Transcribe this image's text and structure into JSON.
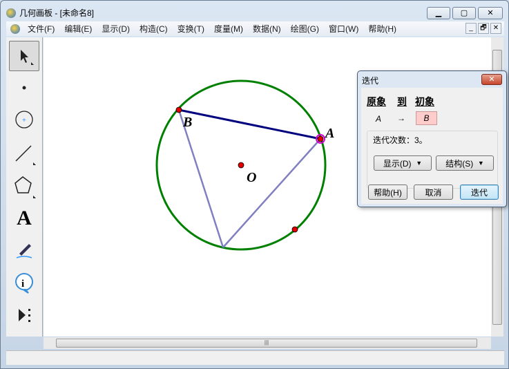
{
  "window": {
    "title": "几何画板 - [未命名8]",
    "min": "▁",
    "max": "▢",
    "close": "✕"
  },
  "menu": [
    "文件(F)",
    "编辑(E)",
    "显示(D)",
    "构造(C)",
    "变换(T)",
    "度量(M)",
    "数据(N)",
    "绘图(G)",
    "窗口(W)",
    "帮助(H)"
  ],
  "mdi": [
    "_",
    "🗗",
    "✕"
  ],
  "tools": {
    "text_tool": "A"
  },
  "canvas": {
    "labels": {
      "A": "A",
      "B": "B",
      "O": "O"
    },
    "colors": {
      "circle": "#008000",
      "segment_ab": "#00007f",
      "segments": "#8080c0",
      "point": "#e00000"
    }
  },
  "dialog": {
    "title": "迭代",
    "close": "✕",
    "header_pre": "原象",
    "header_to": "到",
    "header_init": "初象",
    "pre_value": "A",
    "arrow": "→",
    "init_value": "B",
    "iterations": "迭代次数：3。",
    "display_btn": "显示(D)",
    "structure_btn": "结构(S)",
    "help_btn": "帮助(H)",
    "cancel_btn": "取消",
    "iterate_btn": "迭代",
    "dropdown": "▼"
  },
  "hscroll": {
    "grip": "|||"
  }
}
